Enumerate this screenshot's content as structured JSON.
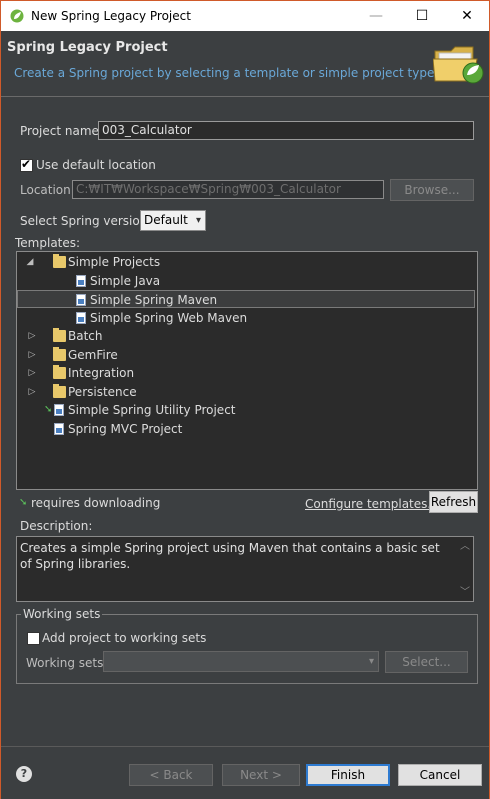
{
  "window": {
    "title": "New Spring Legacy Project",
    "controls": {
      "minimize": "—",
      "maximize": "☐",
      "close": "✕"
    }
  },
  "header": {
    "title": "Spring Legacy Project",
    "subtitle": "Create a Spring project by selecting a template or simple project type."
  },
  "form": {
    "project_name_label": "Project name:",
    "project_name_value": "003_Calculator",
    "use_default_location_label": "Use default location",
    "use_default_location_checked": true,
    "location_label": "Location:",
    "location_value": "C:₩IT₩Workspace₩Spring₩003_Calculator",
    "browse_label": "Browse...",
    "spring_version_label": "Select Spring version:",
    "spring_version_value": "Default"
  },
  "templates": {
    "label": "Templates:",
    "items": [
      {
        "label": "Simple Projects",
        "type": "folder",
        "expanded": true
      },
      {
        "label": "Simple Java",
        "type": "template"
      },
      {
        "label": "Simple Spring Maven",
        "type": "template",
        "selected": true
      },
      {
        "label": "Simple Spring Web Maven",
        "type": "template"
      },
      {
        "label": "Batch",
        "type": "folder",
        "expanded": false
      },
      {
        "label": "GemFire",
        "type": "folder",
        "expanded": false
      },
      {
        "label": "Integration",
        "type": "folder",
        "expanded": false
      },
      {
        "label": "Persistence",
        "type": "folder",
        "expanded": false
      },
      {
        "label": "Simple Spring Utility Project",
        "type": "template",
        "requires_download": true
      },
      {
        "label": "Spring MVC Project",
        "type": "template"
      }
    ],
    "requires_downloading_label": "requires downloading",
    "configure_templates_label": "Configure templates...",
    "refresh_label": "Refresh"
  },
  "description": {
    "label": "Description:",
    "text": "Creates a simple Spring project using Maven that contains a basic set of Spring libraries."
  },
  "working_sets": {
    "group_label": "Working sets",
    "add_label": "Add project to working sets",
    "add_checked": false,
    "sets_label": "Working sets:",
    "sets_value": "",
    "select_label": "Select..."
  },
  "footer": {
    "help_icon": "?",
    "back_label": "< Back",
    "next_label": "Next >",
    "finish_label": "Finish",
    "cancel_label": "Cancel"
  },
  "colors": {
    "window_border": "#d05a2a",
    "background": "#3c3f41",
    "subtitle": "#6aa8d8",
    "folder": "#e8c86a",
    "primary_button_border": "#2e7bd1"
  }
}
